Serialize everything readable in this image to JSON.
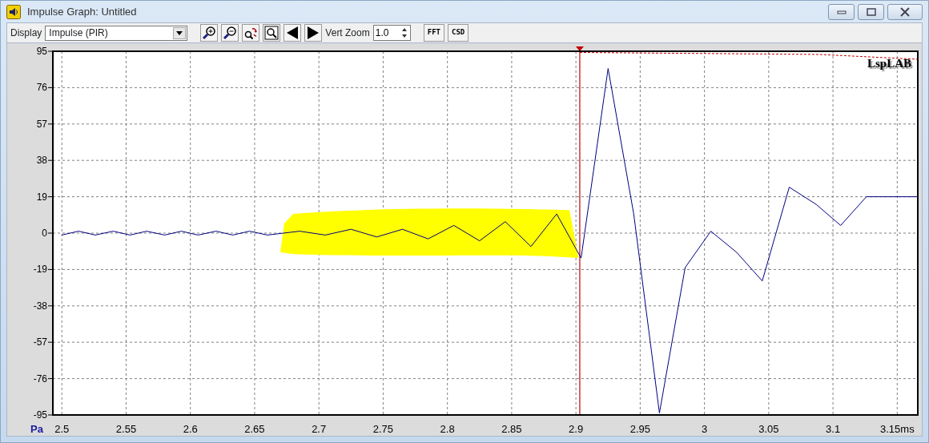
{
  "window": {
    "title": "Impulse Graph: Untitled"
  },
  "toolbar": {
    "display_label": "Display",
    "display_value": "Impulse (PIR)",
    "vert_zoom_label": "Vert Zoom",
    "vert_zoom_value": "1.0",
    "buttons": [
      "FFT",
      "CSD"
    ]
  },
  "graph": {
    "unit_label": "Pa",
    "legend": "LspLAB",
    "chart_data": {
      "type": "line",
      "x": [
        2.5,
        2.513,
        2.526,
        2.54,
        2.553,
        2.566,
        2.58,
        2.593,
        2.606,
        2.62,
        2.633,
        2.646,
        2.66,
        2.685,
        2.705,
        2.725,
        2.745,
        2.765,
        2.785,
        2.805,
        2.825,
        2.845,
        2.865,
        2.885,
        2.904,
        2.925,
        2.945,
        2.965,
        2.985,
        3.005,
        3.025,
        3.045,
        3.066,
        3.087,
        3.106,
        3.126,
        3.166
      ],
      "series": [
        {
          "color": "#000080",
          "values": [
            -1,
            1,
            -1,
            1,
            -1,
            1,
            -1,
            1,
            -1,
            1,
            -1,
            1,
            -1,
            1,
            -1,
            2,
            -2,
            2,
            -3,
            4,
            -4,
            6,
            -7,
            10,
            -13,
            86,
            10,
            -94,
            -18,
            1,
            -10,
            -25,
            24,
            15,
            4,
            19,
            19
          ]
        }
      ],
      "xlim": [
        2.493,
        3.166
      ],
      "ylim": [
        -95,
        95
      ],
      "xticks": [
        2.5,
        2.55,
        2.6,
        2.65,
        2.7,
        2.75,
        2.8,
        2.85,
        2.9,
        2.95,
        3,
        3.05,
        3.1,
        {
          "value": 3.15,
          "label": "3.15ms"
        }
      ],
      "yticks": [
        95,
        76,
        57,
        38,
        19,
        0,
        -19,
        -38,
        -57,
        -76,
        -95
      ],
      "grid": true,
      "ref_lines": [
        {
          "axis": "x",
          "value": 2.903,
          "color": "#c00000"
        }
      ]
    }
  }
}
